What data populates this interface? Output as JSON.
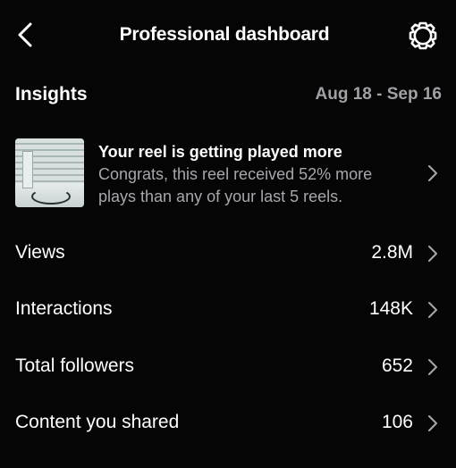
{
  "header": {
    "title": "Professional dashboard",
    "back_icon": "chevron-left-icon",
    "settings_icon": "gear-icon"
  },
  "insights": {
    "label": "Insights",
    "date_range": "Aug 18 - Sep 16"
  },
  "reel_card": {
    "title": "Your reel is getting played more",
    "description": "Congrats, this reel received 52% more plays than any of your last 5 reels."
  },
  "metrics": [
    {
      "label": "Views",
      "value": "2.8M"
    },
    {
      "label": "Interactions",
      "value": "148K"
    },
    {
      "label": "Total followers",
      "value": "652"
    },
    {
      "label": "Content you shared",
      "value": "106"
    }
  ],
  "colors": {
    "background": "#050505",
    "primary_text": "#ffffff",
    "secondary_text": "#a7a7ad"
  }
}
